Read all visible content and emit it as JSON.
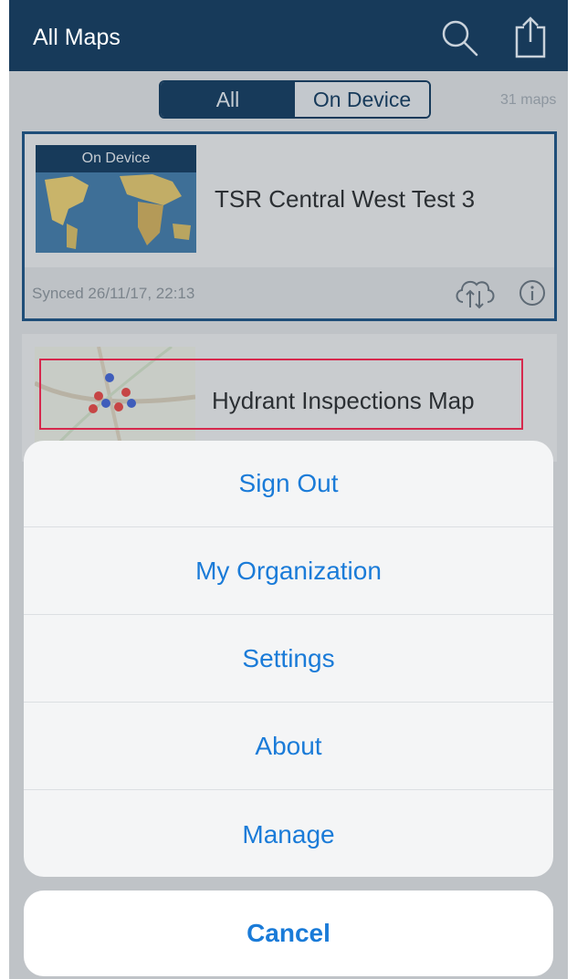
{
  "navbar": {
    "title": "All Maps",
    "icons": [
      "search-icon",
      "share-icon"
    ]
  },
  "segment": {
    "all_label": "All",
    "on_device_label": "On Device",
    "count": "31 maps"
  },
  "maps": [
    {
      "badge": "On Device",
      "title": "TSR Central West Test 3",
      "synced": "Synced 26/11/17, 22:13",
      "icons": [
        "cloud-sync-icon",
        "info-icon"
      ]
    },
    {
      "title": "Hydrant Inspections Map"
    }
  ],
  "action_sheet": {
    "items": [
      "Sign Out",
      "My Organization",
      "Settings",
      "About",
      "Manage"
    ],
    "cancel": "Cancel"
  },
  "colors": {
    "navbar": "#173a5a",
    "action_text": "#1a7bd8",
    "highlight_border": "#d6284d",
    "card_border": "#1f4e79"
  }
}
